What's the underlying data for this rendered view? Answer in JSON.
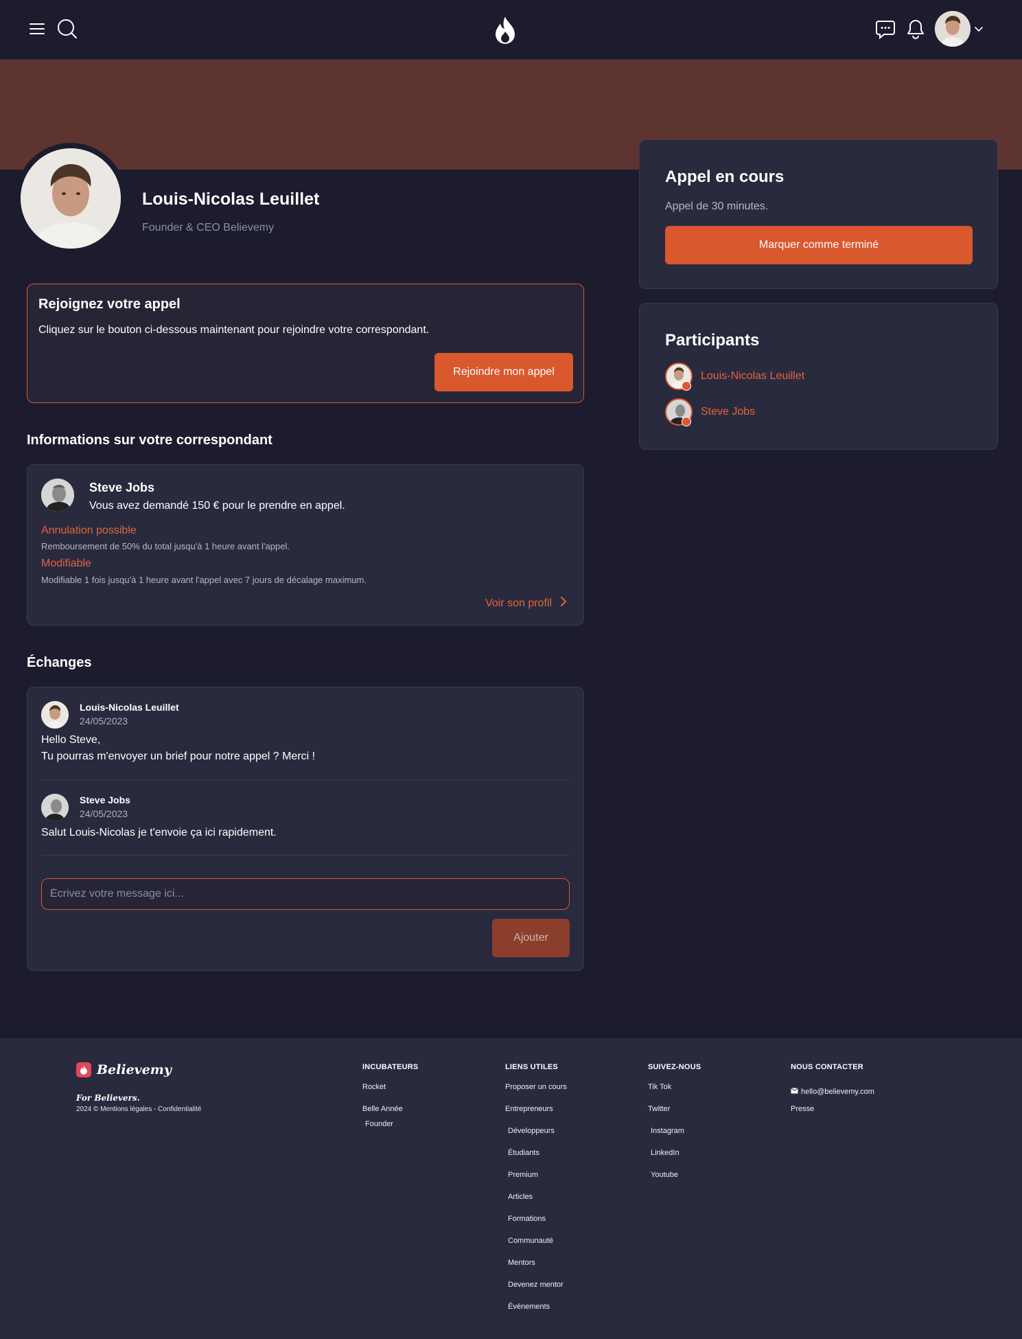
{
  "header": {
    "icons": [
      "menu-icon",
      "search-icon",
      "flame-logo-icon",
      "chat-icon",
      "bell-icon",
      "chevron-down-icon"
    ]
  },
  "profile": {
    "name": "Louis-Nicolas Leuillet",
    "role": "Founder & CEO Believemy"
  },
  "join_call": {
    "title": "Rejoignez votre appel",
    "description": "Cliquez sur le bouton ci-dessous maintenant pour rejoindre votre correspondant.",
    "button": "Rejoindre mon appel"
  },
  "info": {
    "section_title": "Informations sur votre correspondant",
    "name": "Steve Jobs",
    "description": "Vous avez demandé 150 € pour le prendre en appel.",
    "cancel_label": "Annulation possible",
    "cancel_detail": "Remboursement de 50% du total jusqu'à 1 heure avant l'appel.",
    "modify_label": "Modifiable",
    "modify_detail": "Modifiable 1 fois jusqu'à 1 heure avant l'appel avec 7 jours de décalage maximum.",
    "profile_link": "Voir son profil"
  },
  "exchanges": {
    "section_title": "Échanges",
    "messages": [
      {
        "author": "Louis-Nicolas Leuillet",
        "date": "24/05/2023",
        "line1": "Hello Steve,",
        "line2": "Tu pourras m'envoyer un brief pour notre appel ? Merci !"
      },
      {
        "author": "Steve Jobs",
        "date": "24/05/2023",
        "line1": "Salut Louis-Nicolas je t'envoie ça ici rapidement."
      }
    ],
    "input_placeholder": "Écrivez votre message ici...",
    "add_button": "Ajouter"
  },
  "call": {
    "title": "Appel en cours",
    "description": "Appel de 30 minutes.",
    "button": "Marquer comme terminé"
  },
  "participants": {
    "title": "Participants",
    "items": [
      {
        "name": "Louis-Nicolas Leuillet"
      },
      {
        "name": "Steve Jobs"
      }
    ]
  },
  "footer": {
    "brand": "Believemy",
    "tagline": "For Believers.",
    "copyright": "2024 © Mentions légales - Confidentialité",
    "columns": [
      {
        "title": "INCUBATEURS",
        "links": [
          "Rocket",
          "Belle Année",
          "Founder"
        ]
      },
      {
        "title": "LIENS UTILES",
        "links": [
          "Proposer un cours",
          "Entrepreneurs",
          "Développeurs",
          "Étudiants",
          "Premium",
          "Articles",
          "Formations",
          "Communauté",
          "Mentors",
          "Devenez mentor",
          "Événements"
        ]
      },
      {
        "title": "SUIVEZ-NOUS",
        "links": [
          "Tik Tok",
          "Twitter",
          "Instagram",
          "LinkedIn",
          "Youtube"
        ]
      },
      {
        "title": "NOUS CONTACTER",
        "links": [
          "hello@believemy.com",
          "Presse"
        ]
      }
    ]
  },
  "colors": {
    "background": "#1c1c2e",
    "card": "#2a2a3e",
    "accent": "#d9582e",
    "banner": "#5e3431"
  }
}
